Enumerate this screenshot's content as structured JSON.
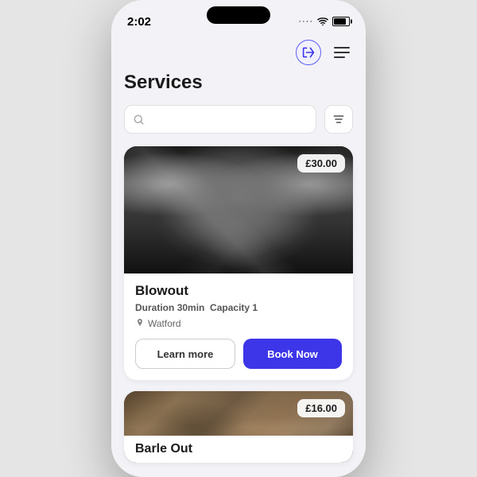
{
  "status_bar": {
    "time": "2:02",
    "dots": "····",
    "wifi": "wifi",
    "battery": "battery"
  },
  "nav": {
    "login_label": "login",
    "menu_label": "menu"
  },
  "page": {
    "title": "Services",
    "search_placeholder": "Search"
  },
  "services": [
    {
      "id": "blowout",
      "title": "Blowout",
      "duration_label": "Duration",
      "duration_value": "30min",
      "capacity_label": "Capacity",
      "capacity_value": "1",
      "location": "Watford",
      "price": "£30.00",
      "learn_more": "Learn more",
      "book_now": "Book Now",
      "type": "blowout"
    },
    {
      "id": "curl",
      "title": "Barle Out",
      "price": "£16.00",
      "type": "curl"
    }
  ],
  "colors": {
    "accent": "#3d35e8",
    "text_primary": "#1a1a1a",
    "text_secondary": "#888888"
  }
}
